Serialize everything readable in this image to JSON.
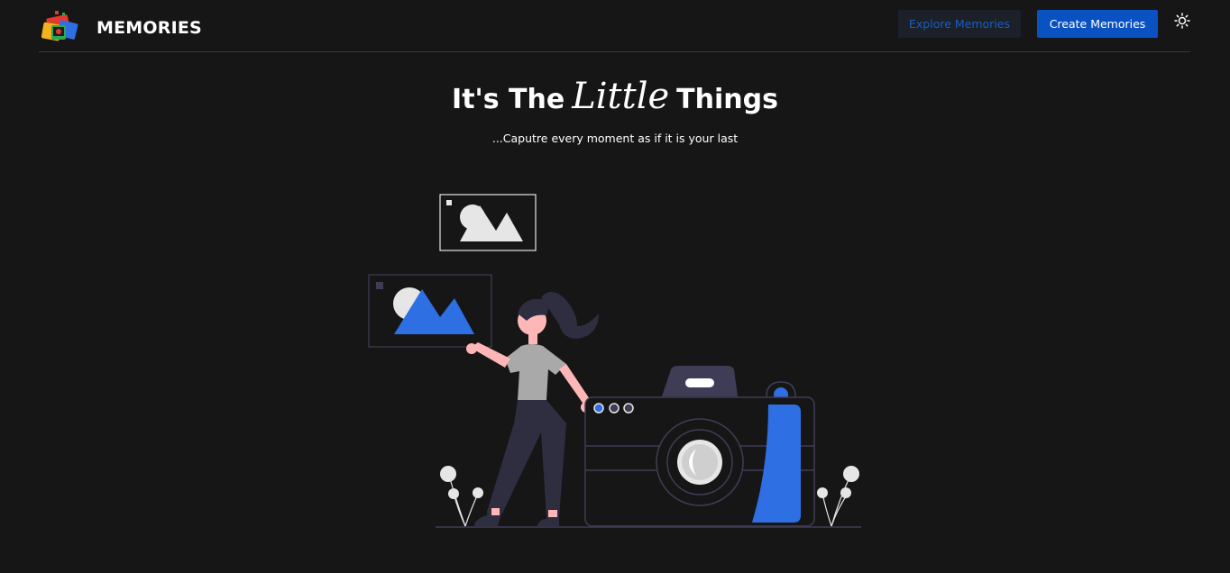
{
  "header": {
    "brand": "MEMORIES",
    "explore_label": "Explore Memories",
    "create_label": "Create Memories"
  },
  "hero": {
    "title_part1": "It's The",
    "title_script": "Little",
    "title_part2": "Things",
    "subtitle": "...Caputre every moment as if it is your last"
  },
  "colors": {
    "background": "#161616",
    "accent": "#0a52c2",
    "illustration_blue": "#2f6fe4"
  },
  "icons": [
    "logo-icon",
    "sun-icon",
    "image-frame-icon",
    "camera-illustration"
  ]
}
